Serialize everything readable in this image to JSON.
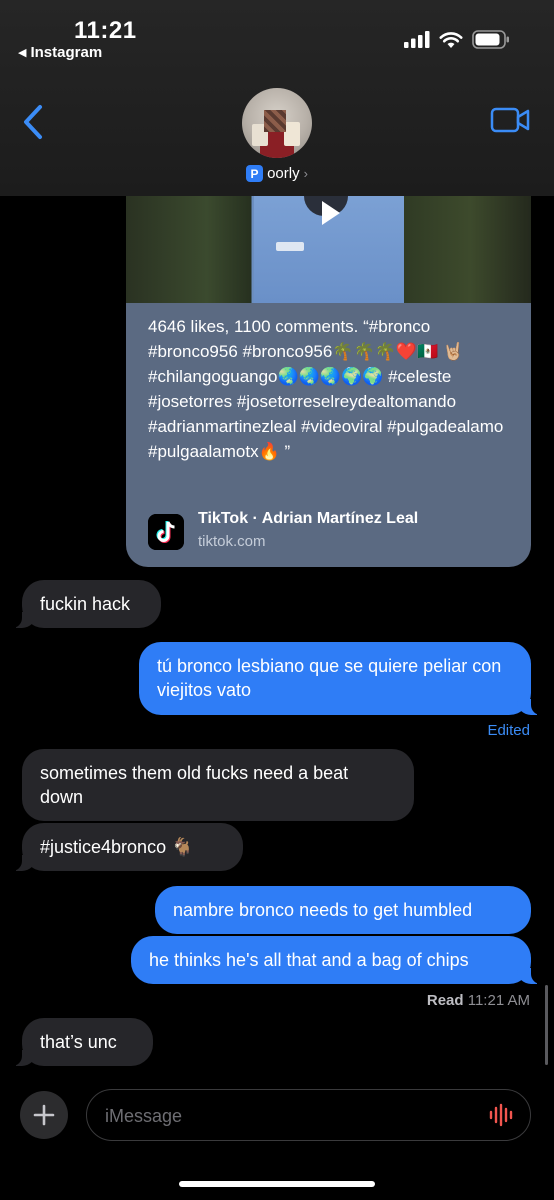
{
  "status": {
    "time": "11:21",
    "back_app": "Instagram"
  },
  "contact": {
    "badge": "P",
    "name": "oorly"
  },
  "icons": {
    "back": "chevron-left-icon",
    "video": "video-camera-icon",
    "add": "plus-icon",
    "voice": "voice-waveform-icon",
    "play": "play-icon"
  },
  "colors": {
    "outgoing_bubble": "#2f7df6",
    "incoming_bubble": "#26262a",
    "link_card": "#5b6a82",
    "edited_text": "#3b8cf6"
  },
  "link_preview": {
    "description": "4646 likes, 1100 comments. “#bronco #bronco956 #bronco956🌴🌴🌴❤️🇲🇽 🤘🏼 #chilangoguango🌏🌏🌏🌍🌍 #celeste #josetorres #josetorreselreydealtomando #adrianmartinezleal #videoviral #pulgadealamo #pulgaalamotx🔥 ”",
    "source_title": "TikTok · Adrian Martínez Leal",
    "domain": "tiktok.com"
  },
  "messages": [
    {
      "dir": "in",
      "text": "fuckin hack"
    },
    {
      "dir": "out",
      "text": "tú bronco lesbiano que se quiere peliar con viejitos vato"
    },
    {
      "dir": "in",
      "text": "sometimes them old fucks need a beat down"
    },
    {
      "dir": "in",
      "text": "#justice4bronco 🐐"
    },
    {
      "dir": "out",
      "text": "nambre bronco needs to get humbled"
    },
    {
      "dir": "out",
      "text": "he thinks he's all that and a bag of chips"
    },
    {
      "dir": "in",
      "text": "that’s unc"
    }
  ],
  "edited_label": "Edited",
  "read_receipt": {
    "label": "Read",
    "time": "11:21 AM"
  },
  "composer": {
    "placeholder": "iMessage"
  }
}
